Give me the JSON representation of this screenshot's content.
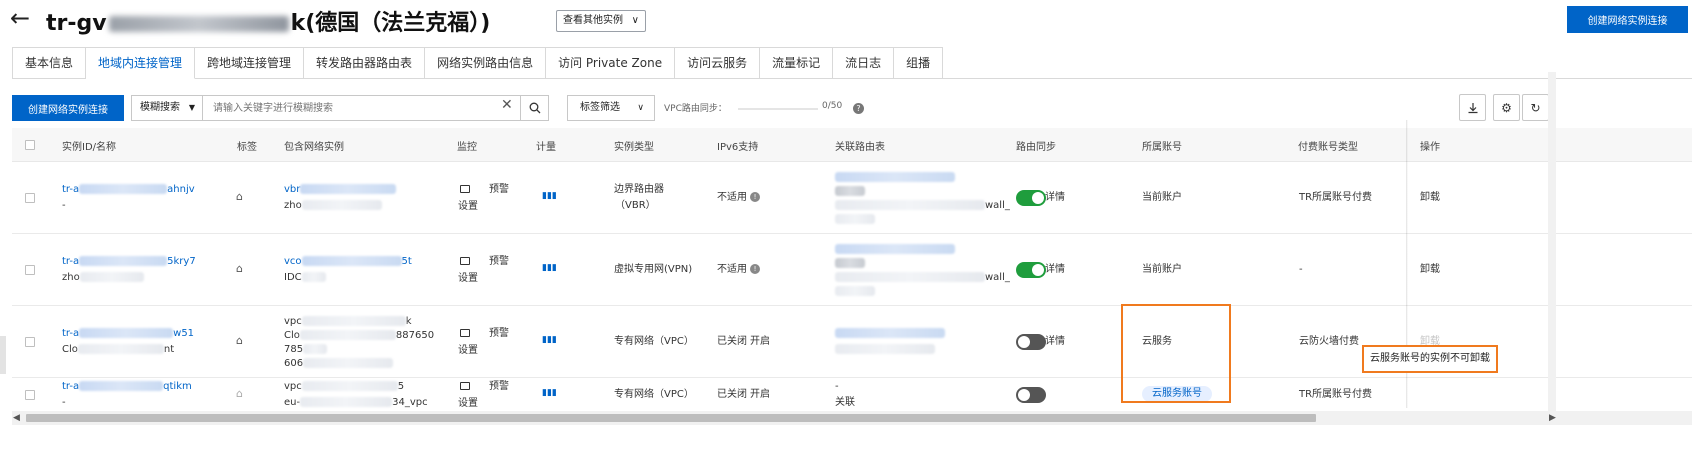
{
  "header": {
    "title_prefix": "tr-gv",
    "title_suffix": "k(德国（法兰克福）)",
    "instance_select": "查看其他实例",
    "create_button": "创建网络实例连接"
  },
  "tabs": [
    {
      "label": "基本信息"
    },
    {
      "label": "地域内连接管理",
      "active": true
    },
    {
      "label": "跨地域连接管理"
    },
    {
      "label": "转发路由器路由表"
    },
    {
      "label": "网络实例路由信息"
    },
    {
      "label": "访问 Private Zone"
    },
    {
      "label": "访问云服务"
    },
    {
      "label": "流量标记"
    },
    {
      "label": "流日志"
    },
    {
      "label": "组播"
    }
  ],
  "toolbar": {
    "create_button": "创建网络实例连接",
    "search_type": "模糊搜索",
    "search_placeholder": "请输入关键字进行模糊搜索",
    "tag_filter": "标签筛选",
    "vpc_sync_label": "VPC路由同步：",
    "vpc_sync_count": "0/50"
  },
  "table": {
    "columns": [
      "实例ID/名称",
      "标签",
      "包含网络实例",
      "监控",
      "计量",
      "实例类型",
      "IPv6支持",
      "关联路由表",
      "路由同步",
      "所属账号",
      "付费账号类型",
      "操作"
    ],
    "rows": [
      {
        "id_prefix": "tr-a",
        "id_suffix": "ahnjv",
        "name": "-",
        "inst_line1": "vbr",
        "inst_line2": "zho",
        "monitor_label": "设置",
        "alarm_label": "预警",
        "type_line1": "边界路由器",
        "type_line2": "（VBR）",
        "ipv6": "不适用",
        "route_extra": "wall_",
        "sync_state": "on",
        "sync_detail": "详情",
        "account": "当前账户",
        "pay_type": "TR所属账号付费",
        "op": "卸载"
      },
      {
        "id_prefix": "tr-a",
        "id_suffix": "5kry7",
        "name": "zho",
        "inst_line1": "vco",
        "inst_line1_suffix": "5t",
        "inst_line2": "IDC",
        "monitor_label": "设置",
        "alarm_label": "预警",
        "type_line1": "虚拟专用网(VPN)",
        "ipv6": "不适用",
        "route_extra": "wall_",
        "sync_state": "on",
        "sync_detail": "详情",
        "account": "当前账户",
        "pay_type": "-",
        "op": "卸载"
      },
      {
        "id_prefix": "tr-a",
        "id_suffix": "w51",
        "name_prefix": "Clo",
        "name_suffix": "nt",
        "inst_line1": "vpc",
        "inst_line1_suffix": "k",
        "inst_line2": "Clo",
        "inst_line2_suffix": "887650",
        "inst_line3": "785",
        "inst_line4": "606",
        "monitor_label": "设置",
        "alarm_label": "预警",
        "type_line1": "专有网络（VPC）",
        "ipv6": "已关闭",
        "ipv6_action": "开启",
        "sync_state": "off",
        "sync_detail": "详情",
        "account": "云服务",
        "pay_type": "云防火墙付费",
        "op": "卸载"
      },
      {
        "id_prefix": "tr-a",
        "id_suffix": "qtikm",
        "name": "-",
        "inst_line1": "vpc",
        "inst_line1_suffix": "5",
        "inst_line2": "eu-",
        "inst_line2_suffix": "34_vpc",
        "monitor_label": "设置",
        "alarm_label": "预警",
        "type_line1": "专有网络（VPC）",
        "ipv6": "已关闭",
        "ipv6_action": "开启",
        "route_line1": "-",
        "route_action": "关联",
        "sync_state": "off",
        "account_badge": "云服务账号",
        "pay_type": "TR所属账号付费"
      }
    ]
  },
  "tooltip": "云服务账号的实例不可卸载",
  "colors": {
    "primary": "#0064c8",
    "highlight": "#f07a1e",
    "toggle_on": "#1f9d3d"
  }
}
